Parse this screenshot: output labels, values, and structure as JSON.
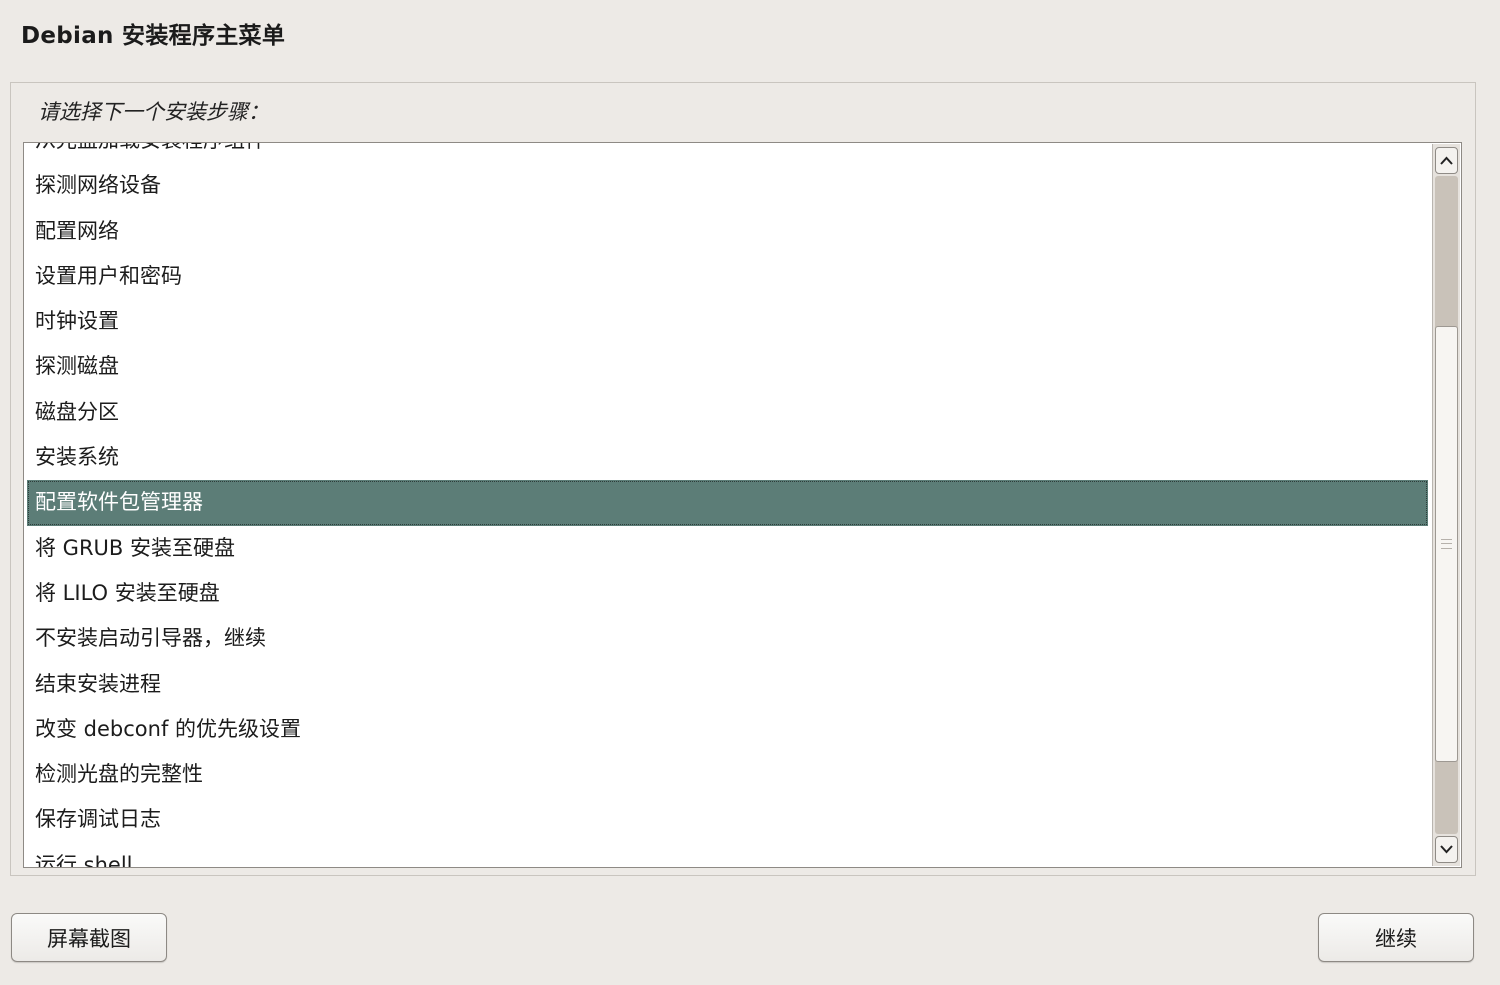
{
  "window": {
    "title": "Debian 安装程序主菜单"
  },
  "prompt": "请选择下一个安装步骤：",
  "menu": {
    "items": [
      "从光盘加载安装程序组件",
      "探测网络设备",
      "配置网络",
      "设置用户和密码",
      "时钟设置",
      "探测磁盘",
      "磁盘分区",
      "安装系统",
      "配置软件包管理器",
      "将 GRUB 安装至硬盘",
      "将 LILO 安装至硬盘",
      "不安装启动引导器，继续",
      "结束安装进程",
      "改变 debconf 的优先级设置",
      "检测光盘的完整性",
      "保存调试日志",
      "运行 shell"
    ],
    "selected_index": 8,
    "selected_color": "#5c7d77"
  },
  "scrollbar": {
    "up_icon": "arrow-up-icon",
    "down_icon": "arrow-down-icon"
  },
  "buttons": {
    "screenshot": "屏幕截图",
    "continue": "继续"
  }
}
